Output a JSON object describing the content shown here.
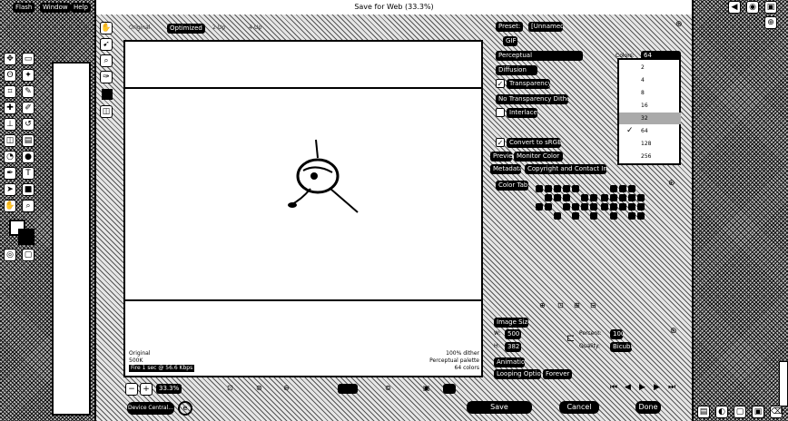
{
  "window_title": "Save for Web (33.3%)",
  "left_app": {
    "top_buttons": [
      "Flash",
      "Window",
      "Help"
    ]
  },
  "preview_tabs": [
    "Original",
    "Optimized",
    "2-Up",
    "4-Up"
  ],
  "settings": {
    "preset_label": "Preset:",
    "preset_value": "[Unnamed]",
    "format_value": "GIF",
    "reduction_value": "Perceptual",
    "dither_value": "Diffusion",
    "transparency_label": "Transparency",
    "matte_value": "No Transparency Dither",
    "interlaced_label": "Interlaced",
    "colors_label": "Colors:",
    "colors_value": "64",
    "convert_srgb_label": "Convert to sRGB",
    "preview_label": "Preview:",
    "preview_value": "Monitor Color",
    "metadata_label": "Metadata:",
    "metadata_value": "Copyright and Contact Info",
    "color_table_tab": "Color Table",
    "image_size_tab": "Image Size",
    "w_label": "W:",
    "w_value": "500",
    "h_label": "H:",
    "h_value": "382",
    "percent_label": "Percent:",
    "percent_value": "100",
    "quality_label": "Quality:",
    "quality_value": "Bicubic",
    "animation_tab": "Animation",
    "looping_label": "Looping Options:",
    "looping_value": "Forever"
  },
  "colors_dropdown": {
    "options": [
      "2",
      "4",
      "8",
      "16",
      "32",
      "64",
      "128",
      "256"
    ],
    "selected": "64",
    "hovered": "32"
  },
  "preview_info": {
    "left_lines": [
      "Original",
      "500K",
      "Fire 1 sec @ 56.6 Kbps"
    ],
    "right_lines": [
      "100% dither",
      "Perceptual palette",
      "64 colors"
    ]
  },
  "bottom_bar": {
    "zoom_value": "33.3%",
    "device_central": "Device Central...",
    "preview_button": "Preview...",
    "save_button": "Save",
    "cancel_button": "Cancel",
    "done_button": "Done"
  }
}
